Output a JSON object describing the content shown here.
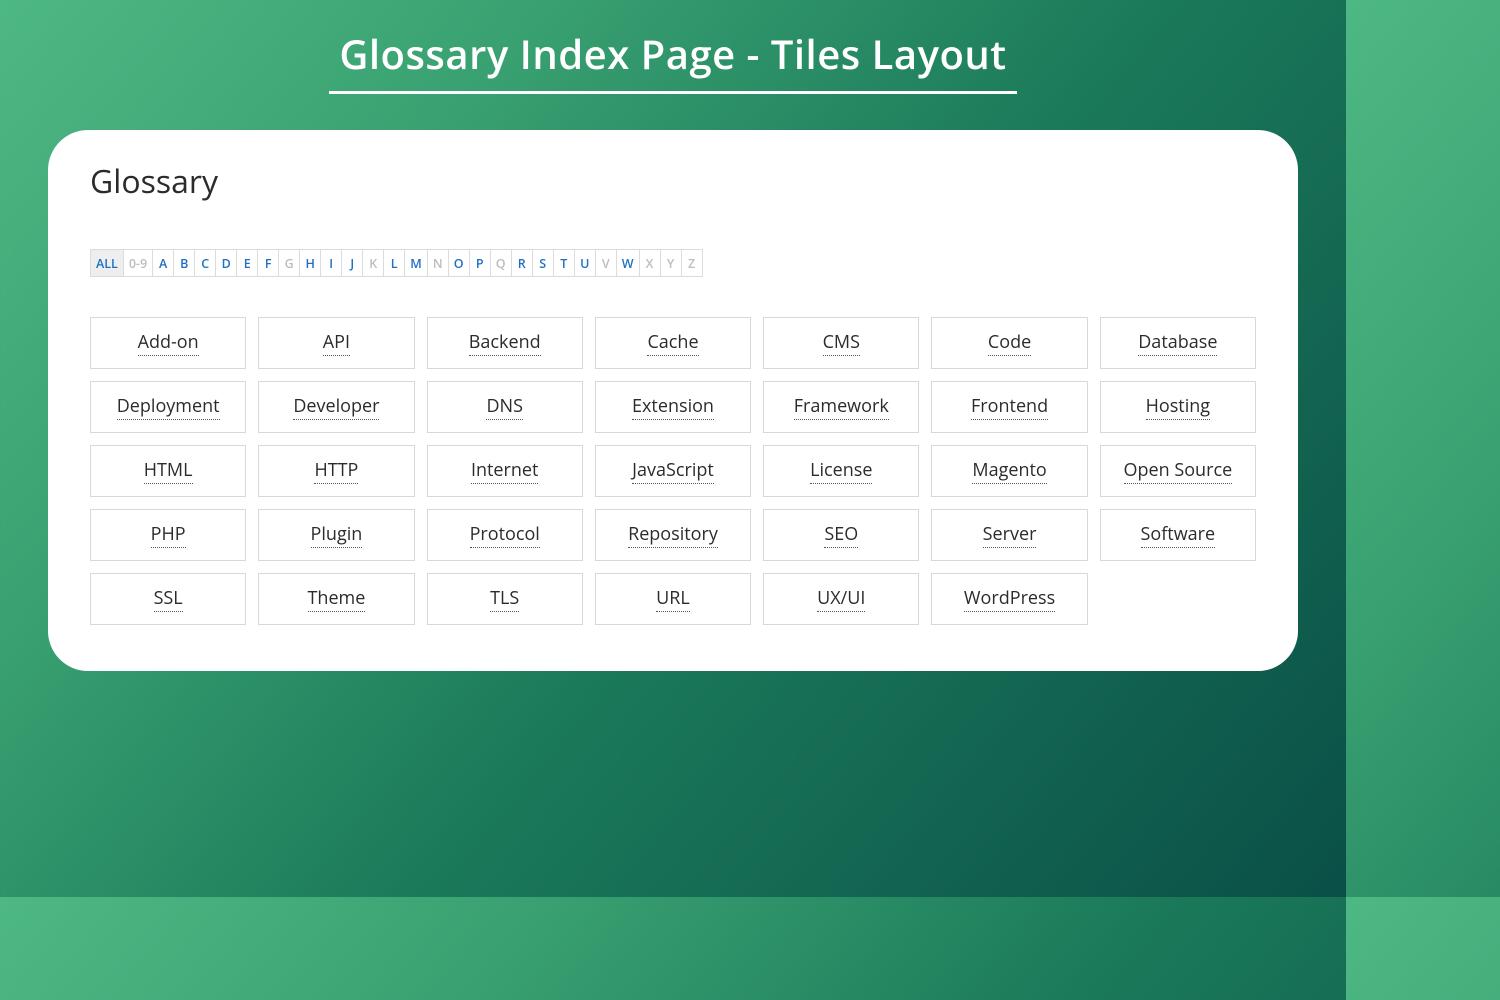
{
  "header": {
    "title": "Glossary Index Page - Tiles Layout"
  },
  "card": {
    "title": "Glossary"
  },
  "alpha": [
    {
      "label": "ALL",
      "state": "all"
    },
    {
      "label": "0-9",
      "state": "disabled"
    },
    {
      "label": "A",
      "state": "active"
    },
    {
      "label": "B",
      "state": "active"
    },
    {
      "label": "C",
      "state": "active"
    },
    {
      "label": "D",
      "state": "active"
    },
    {
      "label": "E",
      "state": "active"
    },
    {
      "label": "F",
      "state": "active"
    },
    {
      "label": "G",
      "state": "disabled"
    },
    {
      "label": "H",
      "state": "active"
    },
    {
      "label": "I",
      "state": "active"
    },
    {
      "label": "J",
      "state": "active"
    },
    {
      "label": "K",
      "state": "disabled"
    },
    {
      "label": "L",
      "state": "active"
    },
    {
      "label": "M",
      "state": "active"
    },
    {
      "label": "N",
      "state": "disabled"
    },
    {
      "label": "O",
      "state": "active"
    },
    {
      "label": "P",
      "state": "active"
    },
    {
      "label": "Q",
      "state": "disabled"
    },
    {
      "label": "R",
      "state": "active"
    },
    {
      "label": "S",
      "state": "active"
    },
    {
      "label": "T",
      "state": "active"
    },
    {
      "label": "U",
      "state": "active"
    },
    {
      "label": "V",
      "state": "disabled"
    },
    {
      "label": "W",
      "state": "active"
    },
    {
      "label": "X",
      "state": "disabled"
    },
    {
      "label": "Y",
      "state": "disabled"
    },
    {
      "label": "Z",
      "state": "disabled"
    }
  ],
  "tiles": [
    "Add-on",
    "API",
    "Backend",
    "Cache",
    "CMS",
    "Code",
    "Database",
    "Deployment",
    "Developer",
    "DNS",
    "Extension",
    "Framework",
    "Frontend",
    "Hosting",
    "HTML",
    "HTTP",
    "Internet",
    "JavaScript",
    "License",
    "Magento",
    "Open Source",
    "PHP",
    "Plugin",
    "Protocol",
    "Repository",
    "SEO",
    "Server",
    "Software",
    "SSL",
    "Theme",
    "TLS",
    "URL",
    "UX/UI",
    "WordPress"
  ]
}
